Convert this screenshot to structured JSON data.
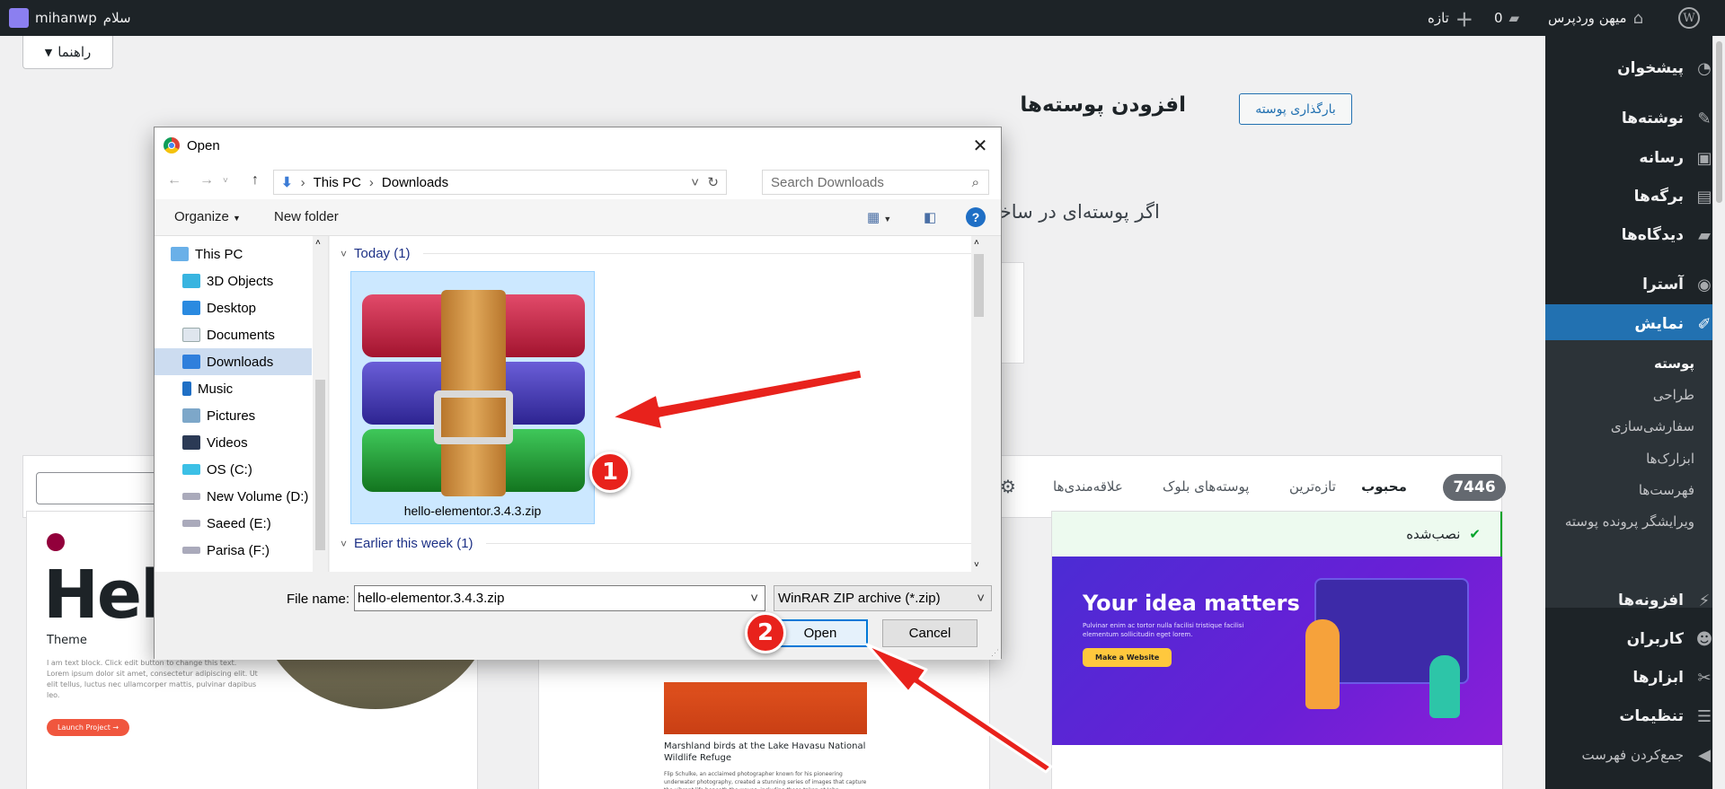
{
  "admin_bar": {
    "greeting": "سلام",
    "username": "mihanwp",
    "site_name": "میهن وردپرس",
    "comments_count": "0",
    "new_label": "تازه"
  },
  "sidebar": {
    "items": [
      {
        "label": "پیشخوان",
        "icon": "dashboard-icon"
      },
      {
        "label": "نوشته‌ها",
        "icon": "pin-icon"
      },
      {
        "label": "رسانه",
        "icon": "media-icon"
      },
      {
        "label": "برگه‌ها",
        "icon": "pages-icon"
      },
      {
        "label": "دیدگاه‌ها",
        "icon": "comments-icon"
      },
      {
        "label": "آسترا",
        "icon": "astra-icon"
      },
      {
        "label": "نمایش",
        "icon": "brush-icon"
      },
      {
        "label": "افزونه‌ها",
        "icon": "plugins-icon"
      },
      {
        "label": "کاربران",
        "icon": "users-icon"
      },
      {
        "label": "ابزارها",
        "icon": "tools-icon"
      },
      {
        "label": "تنظیمات",
        "icon": "settings-icon"
      },
      {
        "label": "جمع‌کردن فهرست",
        "icon": "collapse-icon"
      }
    ],
    "submenu": [
      "پوسته",
      "طراحی",
      "سفارشی‌سازی",
      "ابزارک‌ها",
      "فهرست‌ها",
      "ویرایشگر پرونده پوسته"
    ]
  },
  "page": {
    "help_label": "راهنما",
    "title": "افزودن پوسته‌ها",
    "upload_label": "بارگذاری پوسته",
    "intro_text": "اگر پوسته‌ای در ساختا"
  },
  "filter": {
    "count": "7446",
    "tabs": [
      "محبوب",
      "تازه‌ترین",
      "پوسته‌های بلوک",
      "علاقه‌مندی‌ها"
    ]
  },
  "cards": {
    "hello_brand": "Hel",
    "hello_sub": "Theme",
    "hello_text": "I am text block. Click edit button to change this text. Lorem ipsum dolor sit amet, consectetur adipiscing elit. Ut elit tellus, luctus nec ullamcorper mattis, pulvinar dapibus leo.",
    "hello_button": "Launch Project →",
    "birds_title": "Marshland birds at the Lake Havasu National Wildlife Refuge",
    "birds_text": "Flip Schulke, an acclaimed photographer known for his pioneering underwater photography, created a stunning series of images that capture the vibrant life beneath the waves, including those taken at John Pennekamp Coral Reef State Park, located a few miles off Key Largo. Schulke's work in this series is characterized by its breathtaking clarity and",
    "installed_label": "نصب‌شده",
    "astra_heading": "Your idea matters",
    "astra_text": "Pulvinar enim ac tortor nulla facilisi tristique facilisi elementum sollicitudin eget lorem.",
    "astra_button": "Make a Website"
  },
  "dialog": {
    "title": "Open",
    "breadcrumb": [
      "This PC",
      "Downloads"
    ],
    "search_placeholder": "Search Downloads",
    "organize": "Organize",
    "new_folder": "New folder",
    "nav_items": [
      "This PC",
      "3D Objects",
      "Desktop",
      "Documents",
      "Downloads",
      "Music",
      "Pictures",
      "Videos",
      "OS (C:)",
      "New Volume (D:)",
      "Saeed (E:)",
      "Parisa (F:)"
    ],
    "group_today": "Today (1)",
    "group_earlier": "Earlier this week (1)",
    "file_name": "hello-elementor.3.4.3.zip",
    "file_name_label": "File name:",
    "file_name_value": "hello-elementor.3.4.3.zip",
    "file_type": "WinRAR ZIP archive (*.zip)",
    "open_label": "Open",
    "cancel_label": "Cancel"
  },
  "annotations": {
    "step1": "1",
    "step2": "2"
  },
  "colors": {
    "wp_dark": "#1d2327",
    "wp_blue": "#2271b1",
    "arrow_red": "#e8221c",
    "astra_purple": "#5c1fd6"
  }
}
